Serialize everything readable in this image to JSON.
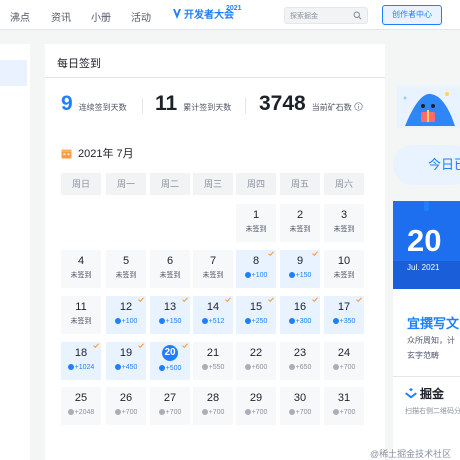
{
  "nav": {
    "items": [
      "沸点",
      "资讯",
      "小册",
      "活动"
    ],
    "event": {
      "text": "开发者大会",
      "year": "2021"
    },
    "search_placeholder": "探索掘金",
    "creator_button": "创作者中心"
  },
  "panel": {
    "title": "每日签到",
    "stats": [
      {
        "value": "9",
        "label": "连续签到天数",
        "accent": true
      },
      {
        "value": "11",
        "label": "累计签到天数",
        "accent": false
      },
      {
        "value": "3748",
        "label": "当前矿石数",
        "accent": false
      }
    ],
    "month": "2021年 7月",
    "weekdays": [
      "周日",
      "周一",
      "周二",
      "周三",
      "周四",
      "周五",
      "周六"
    ],
    "weeks": [
      [
        null,
        null,
        null,
        null,
        {
          "day": "1",
          "sub": "未签到",
          "state": "missed"
        },
        {
          "day": "2",
          "sub": "未签到",
          "state": "missed"
        },
        {
          "day": "3",
          "sub": "未签到",
          "state": "missed"
        }
      ],
      [
        {
          "day": "4",
          "sub": "未签到",
          "state": "missed"
        },
        {
          "day": "5",
          "sub": "未签到",
          "state": "missed"
        },
        {
          "day": "6",
          "sub": "未签到",
          "state": "missed"
        },
        {
          "day": "7",
          "sub": "未签到",
          "state": "missed"
        },
        {
          "day": "8",
          "sub": "+100",
          "state": "signed"
        },
        {
          "day": "9",
          "sub": "+150",
          "state": "signed"
        },
        {
          "day": "10",
          "sub": "未签到",
          "state": "missed"
        }
      ],
      [
        {
          "day": "11",
          "sub": "未签到",
          "state": "missed"
        },
        {
          "day": "12",
          "sub": "+100",
          "state": "signed"
        },
        {
          "day": "13",
          "sub": "+150",
          "state": "signed"
        },
        {
          "day": "14",
          "sub": "+512",
          "state": "signed"
        },
        {
          "day": "15",
          "sub": "+250",
          "state": "signed"
        },
        {
          "day": "16",
          "sub": "+300",
          "state": "signed"
        },
        {
          "day": "17",
          "sub": "+350",
          "state": "signed"
        }
      ],
      [
        {
          "day": "18",
          "sub": "+1024",
          "state": "signed"
        },
        {
          "day": "19",
          "sub": "+450",
          "state": "signed"
        },
        {
          "day": "20",
          "sub": "+500",
          "state": "today"
        },
        {
          "day": "21",
          "sub": "+550",
          "state": "future"
        },
        {
          "day": "22",
          "sub": "+600",
          "state": "future"
        },
        {
          "day": "23",
          "sub": "+650",
          "state": "future"
        },
        {
          "day": "24",
          "sub": "+700",
          "state": "future"
        }
      ],
      [
        {
          "day": "25",
          "sub": "+2048",
          "state": "future"
        },
        {
          "day": "26",
          "sub": "+700",
          "state": "future"
        },
        {
          "day": "27",
          "sub": "+700",
          "state": "future"
        },
        {
          "day": "28",
          "sub": "+700",
          "state": "future"
        },
        {
          "day": "29",
          "sub": "+700",
          "state": "future"
        },
        {
          "day": "30",
          "sub": "+700",
          "state": "future"
        },
        {
          "day": "31",
          "sub": "+700",
          "state": "future"
        }
      ]
    ]
  },
  "right": {
    "today_button": "今日已",
    "card": {
      "day": "20",
      "date": "Jul. 2021",
      "headline": "宜撰写文",
      "lines": [
        "众所周知，计",
        "玄字范畴"
      ],
      "brand": "掘金",
      "footer": "扫描右侧二维码分享"
    }
  },
  "watermark": "@稀土掘金技术社区",
  "colors": {
    "accent": "#1e80ff",
    "signed_bg": "#e8f3ff",
    "cell_bg": "#f7f8fa",
    "check": "#ff9b3d"
  }
}
